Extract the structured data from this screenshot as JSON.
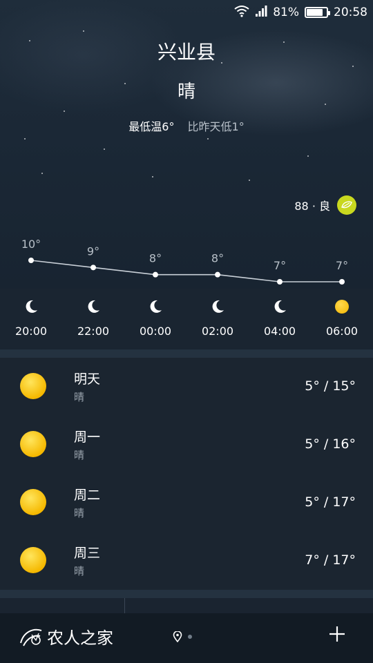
{
  "status_bar": {
    "battery": "81%",
    "time": "20:58",
    "battery_level": 0.81
  },
  "header": {
    "city": "兴业县",
    "condition": "晴",
    "min_temp": "最低温6°",
    "compare": "比昨天低1°"
  },
  "aqi": {
    "label": "88 · 良",
    "color": "#c9d81f"
  },
  "hourly": [
    {
      "temp": "10°",
      "time": "20:00",
      "icon": "moon-icon",
      "value": 10
    },
    {
      "temp": "9°",
      "time": "22:00",
      "icon": "moon-icon",
      "value": 9
    },
    {
      "temp": "8°",
      "time": "00:00",
      "icon": "moon-icon",
      "value": 8
    },
    {
      "temp": "8°",
      "time": "02:00",
      "icon": "moon-icon",
      "value": 8
    },
    {
      "temp": "7°",
      "time": "04:00",
      "icon": "moon-icon",
      "value": 7
    },
    {
      "temp": "7°",
      "time": "06:00",
      "icon": "sun-icon",
      "value": 7
    }
  ],
  "daily": [
    {
      "name": "明天",
      "cond": "晴",
      "temps": "5° / 15°",
      "icon": "sun-icon"
    },
    {
      "name": "周一",
      "cond": "晴",
      "temps": "5° / 16°",
      "icon": "sun-icon"
    },
    {
      "name": "周二",
      "cond": "晴",
      "temps": "5° / 17°",
      "icon": "sun-icon"
    },
    {
      "name": "周三",
      "cond": "晴",
      "temps": "7° / 17°",
      "icon": "sun-icon"
    }
  ],
  "bottom": {
    "watermark": "农人之家"
  },
  "colors": {
    "sun": "#f5b800",
    "accent_aqi": "#c9d81f"
  }
}
